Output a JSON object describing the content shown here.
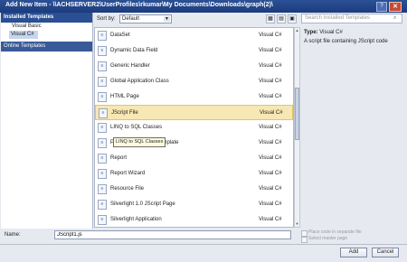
{
  "window": {
    "title": "Add New Item - \\\\ACHSERVER2\\UserProfiles\\rkumar\\My Documents\\Downloads\\graph(2)\\",
    "help_glyph": "?",
    "close_glyph": "✕"
  },
  "left": {
    "installed_header": "Installed Templates",
    "items": [
      "Visual Basic",
      "Visual C#"
    ],
    "online": "Online Templates"
  },
  "sort": {
    "label": "Sort by:",
    "value": "Default",
    "dropdown_glyph": "▼"
  },
  "search": {
    "placeholder": "Search Installed Templates",
    "icon_glyph": "⌕"
  },
  "templates": [
    {
      "name": "DataSet",
      "lang": "Visual C#"
    },
    {
      "name": "Dynamic Data Field",
      "lang": "Visual C#"
    },
    {
      "name": "Generic Handler",
      "lang": "Visual C#"
    },
    {
      "name": "Global Application Class",
      "lang": "Visual C#"
    },
    {
      "name": "HTML Page",
      "lang": "Visual C#"
    },
    {
      "name": "JScript File",
      "lang": "Visual C#"
    },
    {
      "name": "LINQ to SQL Classes",
      "lang": "Visual C#"
    },
    {
      "name": "Preprocessed Text Template",
      "lang": "Visual C#"
    },
    {
      "name": "Report",
      "lang": "Visual C#"
    },
    {
      "name": "Report Wizard",
      "lang": "Visual C#"
    },
    {
      "name": "Resource File",
      "lang": "Visual C#"
    },
    {
      "name": "Silverlight 1.0 JScript Page",
      "lang": "Visual C#"
    },
    {
      "name": "Silverlight Application",
      "lang": "Visual C#"
    }
  ],
  "selected_index": 5,
  "tooltip": "LINQ to SQL Classes",
  "details": {
    "type_label": "Type:",
    "type_value": "Visual C#",
    "description": "A script file containing JScript code"
  },
  "name_field": {
    "label": "Name:",
    "value": "JScript1.js"
  },
  "options": [
    "Place code in separate file",
    "Select master page"
  ],
  "buttons": {
    "add": "Add",
    "cancel": "Cancel"
  }
}
